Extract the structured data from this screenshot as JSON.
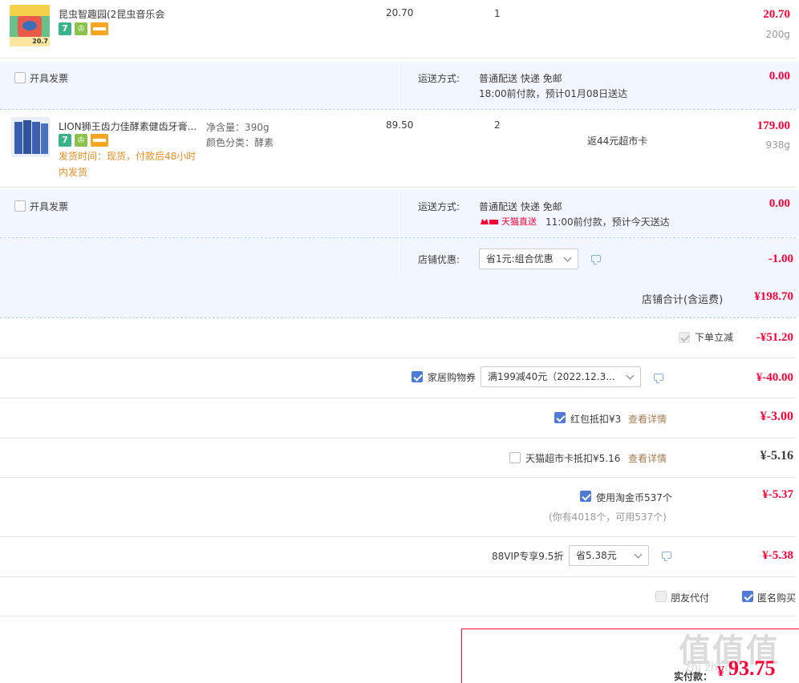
{
  "item1": {
    "title": "昆虫智趣园(2昆虫音乐会",
    "unit_price": "20.70",
    "qty": "1",
    "total": "20.70",
    "weight": "200g",
    "thumb_label": "20.7"
  },
  "block1": {
    "invoice": "开具发票",
    "ship_label": "运送方式:",
    "ship_method": "普通配送 快递 免邮",
    "ship_eta": "18:00前付款，预计01月08日送达",
    "ship_fee": "0.00"
  },
  "item2": {
    "title": "LION狮王齿力佳酵素健齿牙膏...",
    "spec1": "净含量：390g",
    "spec2": "颜色分类：酵素",
    "delivery": "发货时间：现货，付款后48小时内发货",
    "unit_price": "89.50",
    "qty": "2",
    "rebate": "返44元超市卡",
    "total": "179.00",
    "weight": "938g"
  },
  "block2": {
    "invoice": "开具发票",
    "ship_label": "运送方式:",
    "ship_method": "普通配送 快递 免邮",
    "tmall_tag": "天猫直送",
    "ship_eta": "11:00前付款，预计今天送达",
    "ship_fee": "0.00",
    "shop_discount_label": "店铺优惠:",
    "shop_discount_select": "省1元:组合优惠",
    "shop_discount_value": "-1.00",
    "shop_total_label": "店铺合计(含运费)",
    "shop_total": "¥198.70"
  },
  "discounts": {
    "instant": {
      "label": "下单立减",
      "value": "-¥51.20"
    },
    "coupon": {
      "label": "家居购物券",
      "select": "满199减40元（2022.12.3...",
      "value": "¥-40.00"
    },
    "redpacket": {
      "label": "红包抵扣¥3",
      "link": "查看详情",
      "value": "¥-3.00"
    },
    "supercard": {
      "label": "天猫超市卡抵扣¥5.16",
      "link": "查看详情",
      "value": "¥-5.16"
    },
    "taojinbi": {
      "label": "使用淘金币537个",
      "note": "(你有4018个，可用537个)",
      "value": "¥-5.37"
    },
    "vip": {
      "label": "88VIP专享9.5折",
      "select": "省5.38元",
      "value": "¥-5.38"
    }
  },
  "options": {
    "friend_pay": "朋友代付",
    "anonymous": "匿名购买"
  },
  "footer": {
    "pay_label": "实付款：",
    "currency": "¥",
    "pay_amount": "93.75",
    "watermark": "值 值 值",
    "watermark_small": "zhi zhi de"
  },
  "colors": {
    "price_red": "#ff0036",
    "bg_blue": "#f2f7ff",
    "check_blue": "#4d7bd6",
    "link_brown": "#a47e52",
    "delivery_orange": "#f08b1e"
  }
}
